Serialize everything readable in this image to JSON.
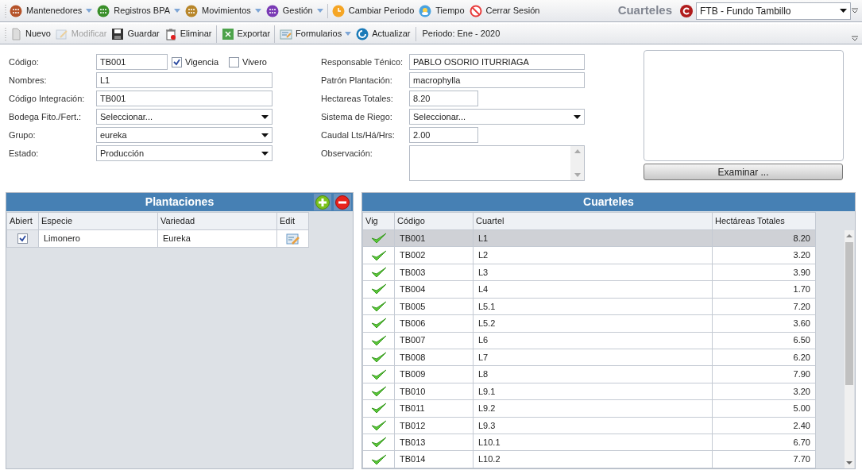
{
  "menu": [
    {
      "label": "Mantenedores",
      "kind": "menu",
      "color": "#b5532a",
      "dropdown": true
    },
    {
      "label": "Registros BPA",
      "kind": "menu",
      "color": "#3a8f2a",
      "dropdown": true
    },
    {
      "label": "Movimientos",
      "kind": "menu",
      "color": "#b8862a",
      "dropdown": true
    },
    {
      "label": "Gestión",
      "kind": "menu",
      "color": "#7a3ab5",
      "dropdown": true
    },
    {
      "label": "Cambiar Periodo",
      "kind": "period",
      "dropdown": false
    },
    {
      "label": "Tiempo",
      "kind": "weather",
      "dropdown": false
    },
    {
      "label": "Cerrar Sesión",
      "kind": "logout",
      "dropdown": false
    }
  ],
  "module_title": "Cuarteles",
  "company_select": {
    "value": "FTB - Fundo Tambillo"
  },
  "toolbar": [
    {
      "label": "Nuevo",
      "kind": "new",
      "disabled": false,
      "dropdown": false,
      "separator_before": false
    },
    {
      "label": "Modificar",
      "kind": "edit",
      "disabled": true,
      "dropdown": false,
      "separator_before": false
    },
    {
      "label": "Guardar",
      "kind": "save",
      "disabled": false,
      "dropdown": false,
      "separator_before": false
    },
    {
      "label": "Eliminar",
      "kind": "delete",
      "disabled": false,
      "dropdown": false,
      "separator_before": false
    },
    {
      "label": "Exportar",
      "kind": "export",
      "disabled": false,
      "dropdown": false,
      "separator_before": true
    },
    {
      "label": "Formularios",
      "kind": "forms",
      "disabled": false,
      "dropdown": true,
      "separator_before": true
    },
    {
      "label": "Actualizar",
      "kind": "refresh",
      "disabled": false,
      "dropdown": false,
      "separator_before": false
    }
  ],
  "period": "Periodo: Ene - 2020",
  "form_left": [
    {
      "label": "Código:",
      "kind": "short_text",
      "value": "TB001",
      "checkboxes": [
        {
          "label": "Vigencia",
          "checked": true
        },
        {
          "label": "Vivero",
          "checked": false
        }
      ]
    },
    {
      "label": "Nombres:",
      "kind": "text",
      "value": "L1"
    },
    {
      "label": "Código Integración:",
      "kind": "text",
      "value": "TB001"
    },
    {
      "label": "Bodega Fito./Fert.:",
      "kind": "select",
      "value": "Seleccionar..."
    },
    {
      "label": "Grupo:",
      "kind": "select",
      "value": "eureka"
    },
    {
      "label": "Estado:",
      "kind": "select",
      "value": "Producción"
    }
  ],
  "form_right": [
    {
      "label": "Responsable Ténico:",
      "kind": "text",
      "value": "PABLO OSORIO ITURRIAGA"
    },
    {
      "label": "Patrón Plantación:",
      "kind": "text",
      "value": "macrophylla"
    },
    {
      "label": "Hectareas Totales:",
      "kind": "short_text",
      "value": "8.20"
    },
    {
      "label": "Sistema de Riego:",
      "kind": "select",
      "value": "Seleccionar..."
    },
    {
      "label": "Caudal Lts/Há/Hrs:",
      "kind": "short_text",
      "value": "2.00"
    },
    {
      "label": "Observación:",
      "kind": "textarea"
    }
  ],
  "image_button": "Examinar ...",
  "plantaciones": {
    "title": "Plantaciones",
    "columns": [
      "Abiert",
      "Especie",
      "Variedad",
      "Edit"
    ],
    "rows": [
      {
        "abierto": true,
        "especie": "Limonero",
        "variedad": "Eureka"
      }
    ]
  },
  "cuarteles": {
    "title": "Cuarteles",
    "columns": [
      "Vig",
      "Código",
      "Cuartel",
      "Hectáreas Totales"
    ],
    "rows": [
      {
        "vig": true,
        "codigo": "TB001",
        "cuartel": "L1",
        "hectareas": "8.20",
        "selected": true
      },
      {
        "vig": true,
        "codigo": "TB002",
        "cuartel": "L2",
        "hectareas": "3.20",
        "selected": false
      },
      {
        "vig": true,
        "codigo": "TB003",
        "cuartel": "L3",
        "hectareas": "3.90",
        "selected": false
      },
      {
        "vig": true,
        "codigo": "TB004",
        "cuartel": "L4",
        "hectareas": "1.70",
        "selected": false
      },
      {
        "vig": true,
        "codigo": "TB005",
        "cuartel": "L5.1",
        "hectareas": "7.20",
        "selected": false
      },
      {
        "vig": true,
        "codigo": "TB006",
        "cuartel": "L5.2",
        "hectareas": "3.60",
        "selected": false
      },
      {
        "vig": true,
        "codigo": "TB007",
        "cuartel": "L6",
        "hectareas": "6.50",
        "selected": false
      },
      {
        "vig": true,
        "codigo": "TB008",
        "cuartel": "L7",
        "hectareas": "6.20",
        "selected": false
      },
      {
        "vig": true,
        "codigo": "TB009",
        "cuartel": "L8",
        "hectareas": "7.90",
        "selected": false
      },
      {
        "vig": true,
        "codigo": "TB010",
        "cuartel": "L9.1",
        "hectareas": "3.20",
        "selected": false
      },
      {
        "vig": true,
        "codigo": "TB011",
        "cuartel": "L9.2",
        "hectareas": "5.00",
        "selected": false
      },
      {
        "vig": true,
        "codigo": "TB012",
        "cuartel": "L9.3",
        "hectareas": "2.40",
        "selected": false
      },
      {
        "vig": true,
        "codigo": "TB013",
        "cuartel": "L10.1",
        "hectareas": "6.70",
        "selected": false
      },
      {
        "vig": true,
        "codigo": "TB014",
        "cuartel": "L10.2",
        "hectareas": "7.70",
        "selected": false
      }
    ]
  }
}
